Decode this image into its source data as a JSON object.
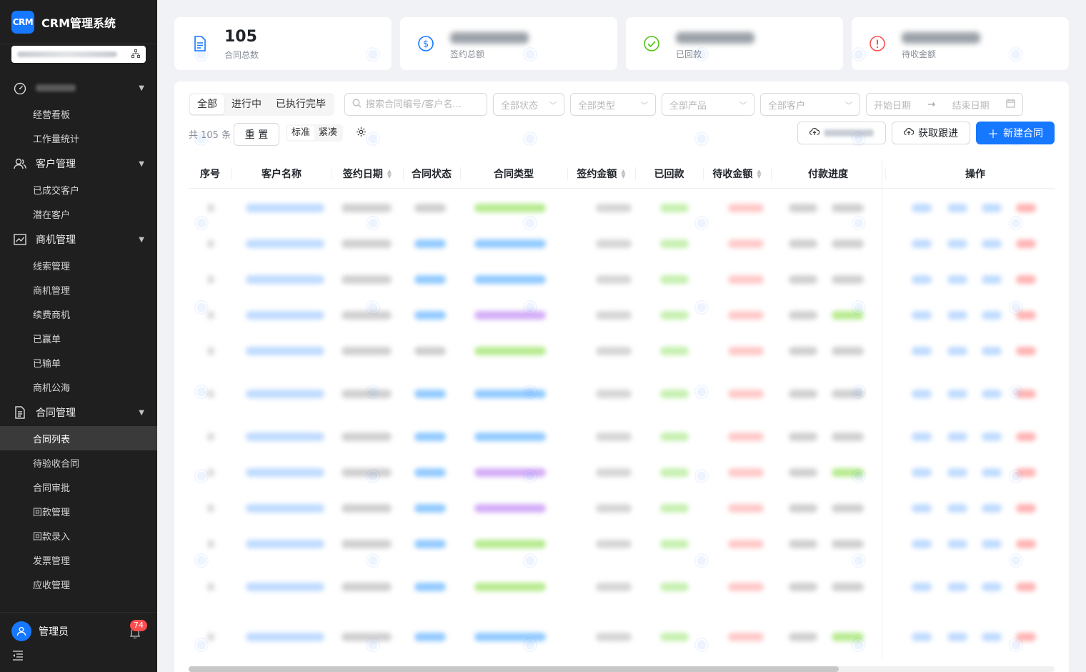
{
  "app": {
    "logo_text": "CRM",
    "title": "CRM管理系统"
  },
  "sidebar": {
    "groups": [
      {
        "label": "",
        "icon": "dashboard-icon",
        "items": [
          "经营看板",
          "工作量统计"
        ]
      },
      {
        "label": "客户管理",
        "icon": "user-icon",
        "items": [
          "已成交客户",
          "潜在客户"
        ]
      },
      {
        "label": "商机管理",
        "icon": "chart-icon",
        "items": [
          "线索管理",
          "商机管理",
          "续费商机",
          "已赢单",
          "已输单",
          "商机公海"
        ]
      },
      {
        "label": "合同管理",
        "icon": "document-icon",
        "items": [
          "合同列表",
          "待验收合同",
          "合同审批",
          "回款管理",
          "回款录入",
          "发票管理",
          "应收管理"
        ]
      }
    ],
    "active_item": "合同列表",
    "user": {
      "name": "管理员",
      "notifications": "74"
    }
  },
  "stats": [
    {
      "value": "105",
      "label": "合同总数",
      "icon": "document-icon",
      "color": "#1677ff"
    },
    {
      "value": "",
      "label": "签约总额",
      "icon": "dollar-icon",
      "color": "#1677ff"
    },
    {
      "value": "",
      "label": "已回款",
      "icon": "check-circle-icon",
      "color": "#52c41a"
    },
    {
      "value": "",
      "label": "待收金额",
      "icon": "exclamation-circle-icon",
      "color": "#ff4d4f"
    }
  ],
  "filters": {
    "tabs": [
      "全部",
      "进行中",
      "已执行完毕"
    ],
    "active_tab": "全部",
    "search_placeholder": "搜索合同编号/客户名...",
    "status": "全部状态",
    "type": "全部类型",
    "product": "全部产品",
    "customer": "全部客户",
    "start_date": "开始日期",
    "end_date": "结束日期"
  },
  "toolbar": {
    "total": "共 105 条",
    "reset": "重 置",
    "density": [
      "标准",
      "紧凑"
    ],
    "fetch_follow": "获取跟进",
    "new_contract": "新建合同"
  },
  "table": {
    "columns": [
      "序号",
      "客户名称",
      "签约日期",
      "合同状态",
      "合同类型",
      "签约金额",
      "已回款",
      "待收金额",
      "付款进度",
      "操作"
    ]
  },
  "colors": {
    "primary": "#1677ff",
    "success": "#52c41a",
    "danger": "#ff4d4f",
    "purple": "#a078e6"
  }
}
